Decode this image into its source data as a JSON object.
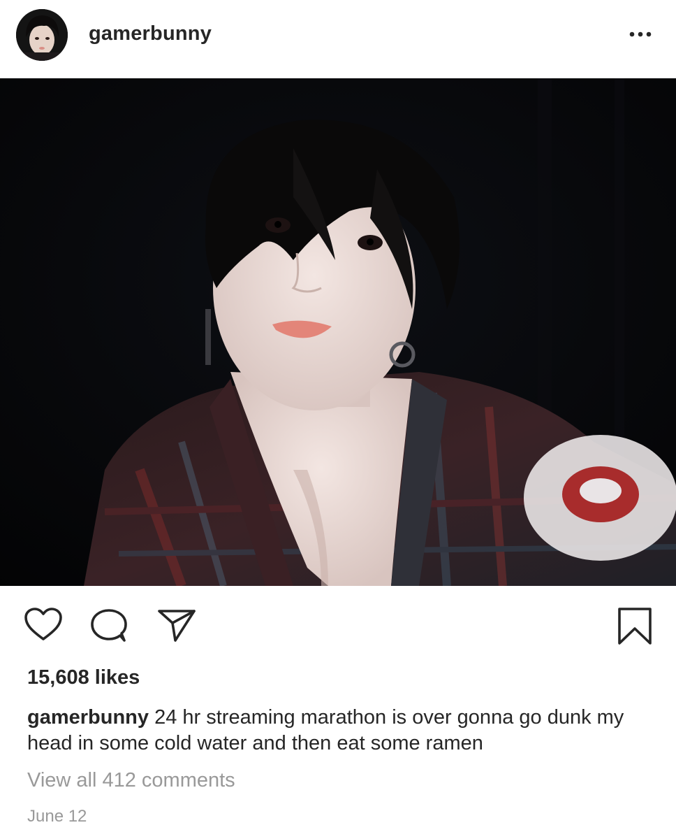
{
  "post": {
    "username": "gamerbunny",
    "likes": "15,608 likes",
    "caption": {
      "username": "gamerbunny",
      "text": "24 hr streaming marathon is over gonna go dunk my head in some cold water and then eat some ramen"
    },
    "view_comments": "View all 412 comments",
    "date": "June 12"
  },
  "icons": {
    "more": "more-horizontal-icon",
    "like": "heart-icon",
    "comment": "comment-bubble-icon",
    "share": "paper-plane-icon",
    "save": "bookmark-icon"
  },
  "colors": {
    "text": "#262626",
    "secondary_text": "#999999",
    "background": "#ffffff",
    "photo_background": "#050505"
  }
}
